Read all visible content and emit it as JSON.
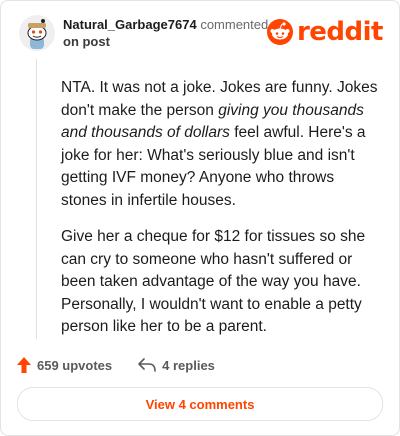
{
  "comment": {
    "username": "Natural_Garbage7674",
    "action_text": "commented",
    "on_text": "on post",
    "paragraphs": [
      {
        "before": "NTA. It was not a joke. Jokes are funny. Jokes don't make the person ",
        "emphasis": "giving you thousands and thousands of dollars",
        "after": " feel awful. Here's a joke for her: What's seriously blue and isn't getting IVF money? Anyone who throws stones in infertile houses."
      },
      {
        "text": "Give her a cheque for $12 for tissues so she can cry to someone who hasn't suffered or been taken advantage of the way you have. Personally, I wouldn't want to enable a petty person like her to be a parent."
      }
    ]
  },
  "brand": {
    "logo_text": "reddit",
    "accent": "#ff4500"
  },
  "actions": {
    "upvotes_label": "659 upvotes",
    "replies_label": "4 replies"
  },
  "footer": {
    "view_comments_label": "View 4 comments"
  },
  "icons": {
    "avatar": "snoo-avatar-icon",
    "logo": "reddit-snoo-icon",
    "upvote": "upvote-arrow-icon",
    "reply": "reply-arrow-icon"
  }
}
